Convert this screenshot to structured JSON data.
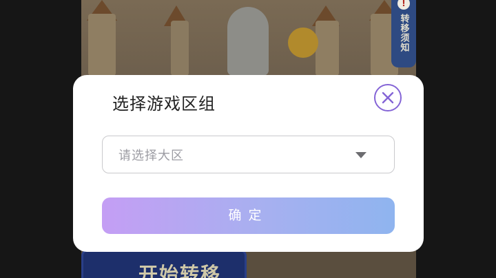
{
  "background": {
    "start_button_label": "开始转移",
    "side_tab_label": "转移须知",
    "side_tab_alert": "!"
  },
  "modal": {
    "title": "选择游戏区组",
    "close_icon": "close-circle-icon",
    "region_select": {
      "placeholder": "请选择大区",
      "caret_icon": "caret-down-icon"
    },
    "confirm_label": "确定"
  },
  "colors": {
    "accent_purple": "#8464d6",
    "button_gradient_start": "#c49ef4",
    "button_gradient_end": "#8fb4ef"
  }
}
